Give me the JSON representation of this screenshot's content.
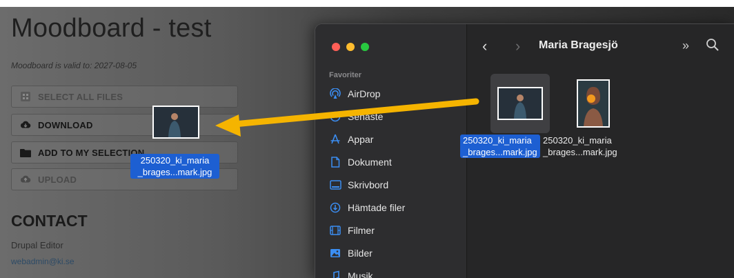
{
  "webpage": {
    "title": "Moodboard - test",
    "validity": "Moodboard is valid to: 2027-08-05",
    "buttons": {
      "select_all": "SELECT ALL FILES",
      "download": "DOWNLOAD",
      "add_selection": "ADD TO MY SELECTION",
      "upload": "UPLOAD"
    },
    "contact": {
      "heading": "CONTACT",
      "name": "Drupal Editor",
      "email": "webadmin@ki.se"
    }
  },
  "drag": {
    "label_line1": "250320_ki_maria",
    "label_line2": "_brages...mark.jpg"
  },
  "finder": {
    "folder_title": "Maria Bragesjö",
    "sidebar": {
      "section": "Favoriter",
      "items": [
        {
          "label": "AirDrop",
          "icon": "airdrop-icon"
        },
        {
          "label": "Senaste",
          "icon": "clock-icon"
        },
        {
          "label": "Appar",
          "icon": "apps-icon"
        },
        {
          "label": "Dokument",
          "icon": "document-icon"
        },
        {
          "label": "Skrivbord",
          "icon": "desktop-icon"
        },
        {
          "label": "Hämtade filer",
          "icon": "download-icon"
        },
        {
          "label": "Filmer",
          "icon": "film-icon"
        },
        {
          "label": "Bilder",
          "icon": "photo-icon"
        },
        {
          "label": "Musik",
          "icon": "music-icon"
        }
      ]
    },
    "files": [
      {
        "line1": "250320_ki_maria",
        "line2": "_brages...mark.jpg",
        "selected": true
      },
      {
        "line1": "250320_ki_maria",
        "line2": "_brages...mark.jpg",
        "selected": false
      }
    ]
  },
  "colors": {
    "accent_selection": "#1d5fd2",
    "arrow": "#f5b400",
    "traffic_close": "#ff5f57",
    "traffic_min": "#febc2e",
    "traffic_max": "#28c840",
    "sidebar_icon": "#3b8ef3"
  }
}
